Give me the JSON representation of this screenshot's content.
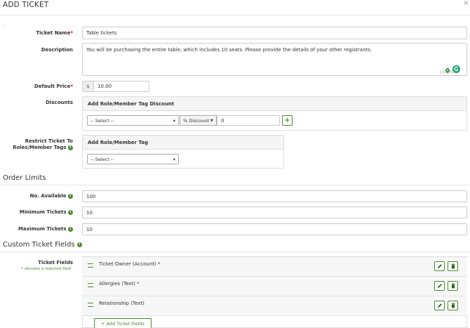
{
  "modal": {
    "title": "ADD TICKET",
    "close": "×",
    "dot": "."
  },
  "labels": {
    "ticket_name": "Ticket Name",
    "description": "Description",
    "default_price": "Default Price",
    "discounts": "Discounts",
    "restrict_line1": "Restrict Ticket To",
    "restrict_line2": "Roles/Member Tags",
    "required_mark": "*"
  },
  "fields": {
    "ticket_name": "Table tickets",
    "description": "You will be purchasing the entire table, which includes 10 seats. Please provide the details of your other registrants.",
    "char_count": "[197/500]",
    "currency": "$",
    "default_price": "10.00"
  },
  "discounts": {
    "header": "Add Role/Member Tag Discount",
    "select_value": "-- Select --",
    "type_value": "% Discount",
    "amount": "0",
    "add": "+"
  },
  "restrict": {
    "header": "Add Role/Member Tag",
    "select_value": "-- Select --"
  },
  "order_limits": {
    "title": "Order Limits",
    "available_label": "No. Available",
    "available_value": "100",
    "min_label": "Minimum Tickets",
    "min_value": "10",
    "max_label": "Maximum Tickets",
    "max_value": "10"
  },
  "custom_fields": {
    "title": "Custom Ticket Fields",
    "label": "Ticket Fields",
    "note": "* denotes a required field",
    "items": [
      "Ticket Owner (Account) *",
      "Allergies (Text) *",
      "Relationship (Text)"
    ],
    "add_button": "+ Add Ticket Fields"
  },
  "colors": {
    "accent": "#4a8a2e",
    "required": "#c00000"
  }
}
